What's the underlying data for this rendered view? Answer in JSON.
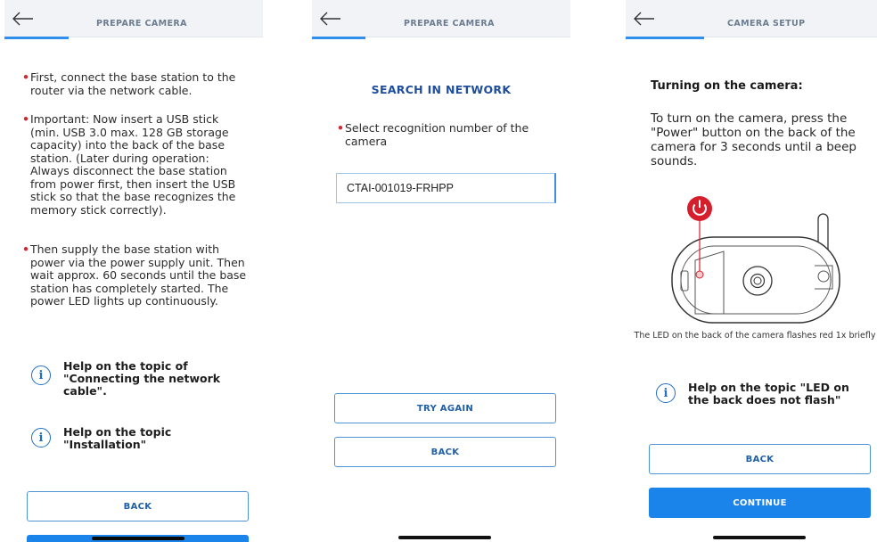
{
  "screens": [
    {
      "header": {
        "back": "back-arrow-icon",
        "title": "PREPARE CAMERA"
      },
      "bullets": [
        "First, connect the base station to the router via the network cable.",
        "Important: Now insert a USB stick (min. USB 3.0 max. 128 GB storage capacity) into the back of the base station. (Later during operation: Always disconnect the base station from power first, then insert the USB stick so that the base recognizes the memory stick correctly).",
        "Then supply the base station with power via the power supply unit. Then wait approx. 60 seconds until the base station has completely started. The power LED lights up continuously."
      ],
      "help": [
        {
          "icon": "info-icon",
          "text": "Help on the topic of \"Connecting the network cable\"."
        },
        {
          "icon": "info-icon",
          "text": "Help on the topic \"Installation\""
        }
      ],
      "back_button": "BACK"
    },
    {
      "header": {
        "back": "back-arrow-icon",
        "title": "PREPARE CAMERA"
      },
      "section_title": "SEARCH IN NETWORK",
      "bullet": "Select recognition number of the camera",
      "field_value": "CTAI-001019-FRHPP",
      "try_again_button": "TRY AGAIN",
      "back_button": "BACK"
    },
    {
      "header": {
        "back": "back-arrow-icon",
        "title": "CAMERA SETUP"
      },
      "heading": "Turning on the camera:",
      "paragraph": "To turn on the camera, press the \"Power\" button on the back of the camera for 3 seconds until a beep sounds.",
      "illustration": "camera-back-illustration",
      "caption": "The LED on the back of the camera flashes red 1x briefly",
      "help": {
        "icon": "info-icon",
        "text": "Help on the topic \"LED on the back does not flash\""
      },
      "back_button": "BACK",
      "continue_button": "CONTINUE"
    }
  ],
  "colors": {
    "accent": "#1a84ea",
    "header_bg": "#f1f3f6",
    "header_title": "#6c7d92",
    "bullet_dot": "#d22630",
    "power_red": "#d61f2c"
  }
}
